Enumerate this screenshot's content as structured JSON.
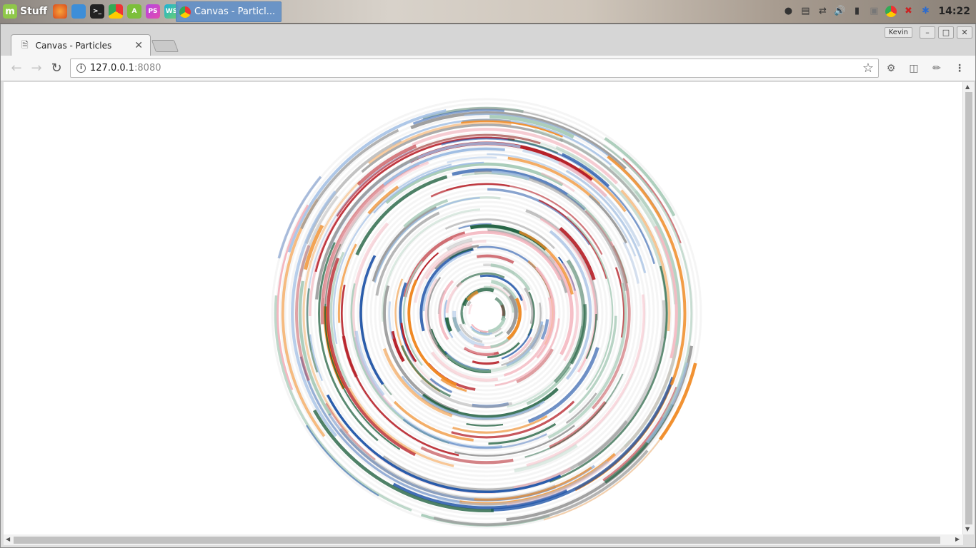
{
  "panel": {
    "menu_label": "Stuff",
    "launchers": [
      "firefox-icon",
      "files-icon",
      "terminal-icon",
      "chrome-icon",
      "android-studio-icon",
      "phpstorm-icon",
      "webstorm-icon"
    ],
    "task_label": "Canvas - Particl...",
    "clock": "14:22"
  },
  "browser": {
    "profile": "Kevin",
    "tab_title": "Canvas - Particles",
    "url_host": "127.0.0.1",
    "url_port": ":8080"
  },
  "canvas": {
    "colors": [
      "#1a5c3a",
      "#b7222a",
      "#f08a24",
      "#1f54a8",
      "#9a9a9a",
      "#f4b6bf",
      "#9fbde3",
      "#a9ccb9"
    ],
    "background": "#ffffff"
  }
}
